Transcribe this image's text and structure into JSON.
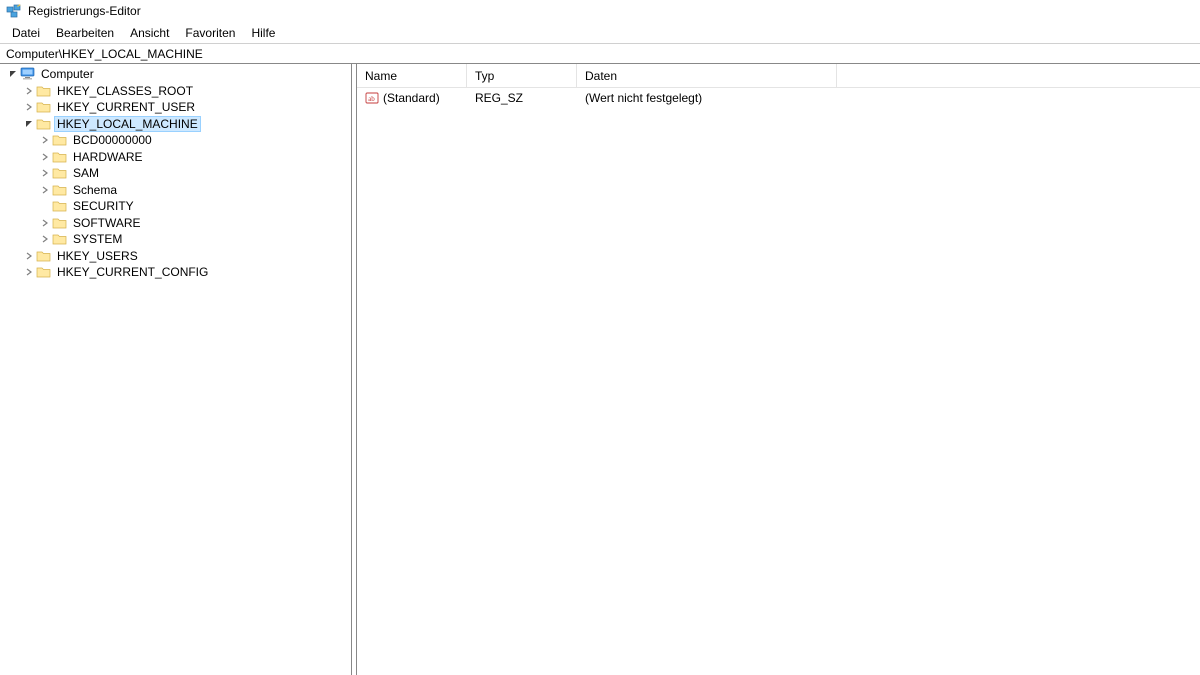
{
  "window": {
    "title": "Registrierungs-Editor"
  },
  "menu": {
    "file": "Datei",
    "edit": "Bearbeiten",
    "view": "Ansicht",
    "favorites": "Favoriten",
    "help": "Hilfe"
  },
  "addressbar": {
    "path": "Computer\\HKEY_LOCAL_MACHINE"
  },
  "tree": {
    "root": "Computer",
    "hives": {
      "hkcr": "HKEY_CLASSES_ROOT",
      "hkcu": "HKEY_CURRENT_USER",
      "hklm": "HKEY_LOCAL_MACHINE",
      "hku": "HKEY_USERS",
      "hkcc": "HKEY_CURRENT_CONFIG"
    },
    "hklm_children": {
      "bcd": "BCD00000000",
      "hardware": "HARDWARE",
      "sam": "SAM",
      "schema": "Schema",
      "security": "SECURITY",
      "software": "SOFTWARE",
      "system": "SYSTEM"
    }
  },
  "list": {
    "headers": {
      "name": "Name",
      "type": "Typ",
      "data": "Daten"
    },
    "rows": [
      {
        "name": "(Standard)",
        "type": "REG_SZ",
        "data": "(Wert nicht festgelegt)"
      }
    ]
  }
}
